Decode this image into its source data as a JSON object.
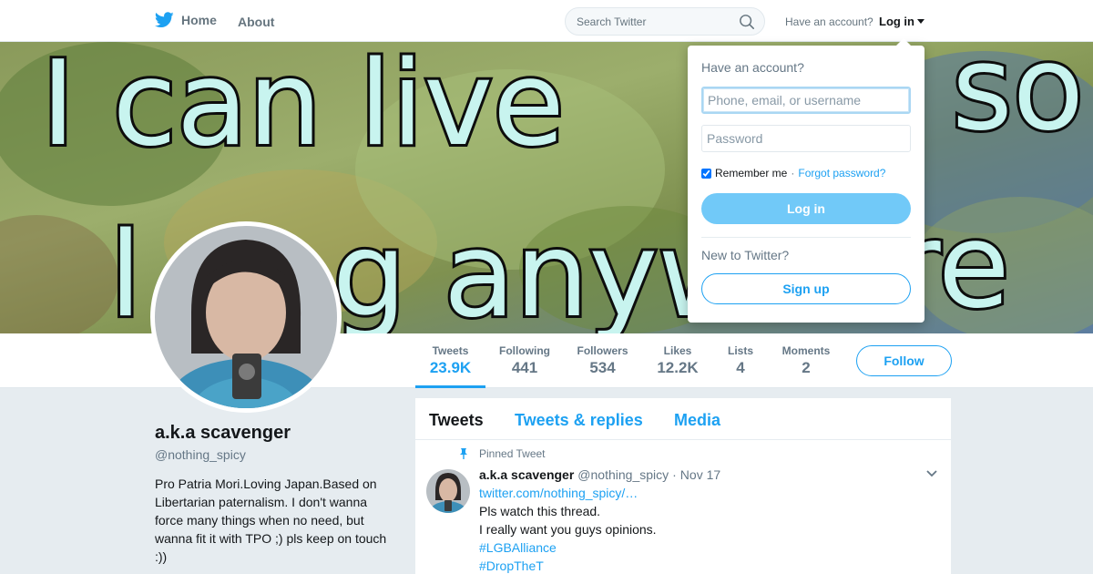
{
  "nav": {
    "home_label": "Home",
    "about_label": "About",
    "search_placeholder": "Search Twitter",
    "have_account": "Have an account?",
    "login_label": "Log in"
  },
  "banner": {
    "line1": "I can live",
    "line1_right": "so",
    "line2_left": "l",
    "line2_mid": "g anyw",
    "line2_right": "re"
  },
  "stats": [
    {
      "label": "Tweets",
      "value": "23.9K"
    },
    {
      "label": "Following",
      "value": "441"
    },
    {
      "label": "Followers",
      "value": "534"
    },
    {
      "label": "Likes",
      "value": "12.2K"
    },
    {
      "label": "Lists",
      "value": "4"
    },
    {
      "label": "Moments",
      "value": "2"
    }
  ],
  "follow_label": "Follow",
  "profile": {
    "name": "a.k.a scavenger",
    "handle": "@nothing_spicy",
    "bio": "Pro Patria Mori.Loving Japan.Based on Libertarian paternalism. I don't wanna force many things when no need, but wanna fit it with TPO ;) pls keep on touch :))"
  },
  "timeline": {
    "tabs": [
      "Tweets",
      "Tweets & replies",
      "Media"
    ],
    "pinned_label": "Pinned Tweet",
    "tweet": {
      "name": "a.k.a scavenger",
      "handle": "@nothing_spicy",
      "dot": "·",
      "time": "Nov 17",
      "link": "twitter.com/nothing_spicy/…",
      "line1": "Pls watch this thread.",
      "line2": "I really want you guys opinions.",
      "hashtag1": "#LGBAlliance",
      "hashtag2": "#DropTheT"
    }
  },
  "login_dropdown": {
    "title": "Have an account?",
    "username_placeholder": "Phone, email, or username",
    "password_placeholder": "Password",
    "remember_label": "Remember me",
    "separator": "·",
    "forgot_label": "Forgot password?",
    "login_button": "Log in",
    "new_label": "New to Twitter?",
    "signup_button": "Sign up"
  },
  "colors": {
    "accent": "#1da1f2",
    "login_button": "#71c9f8",
    "background": "#e6ecf0"
  }
}
